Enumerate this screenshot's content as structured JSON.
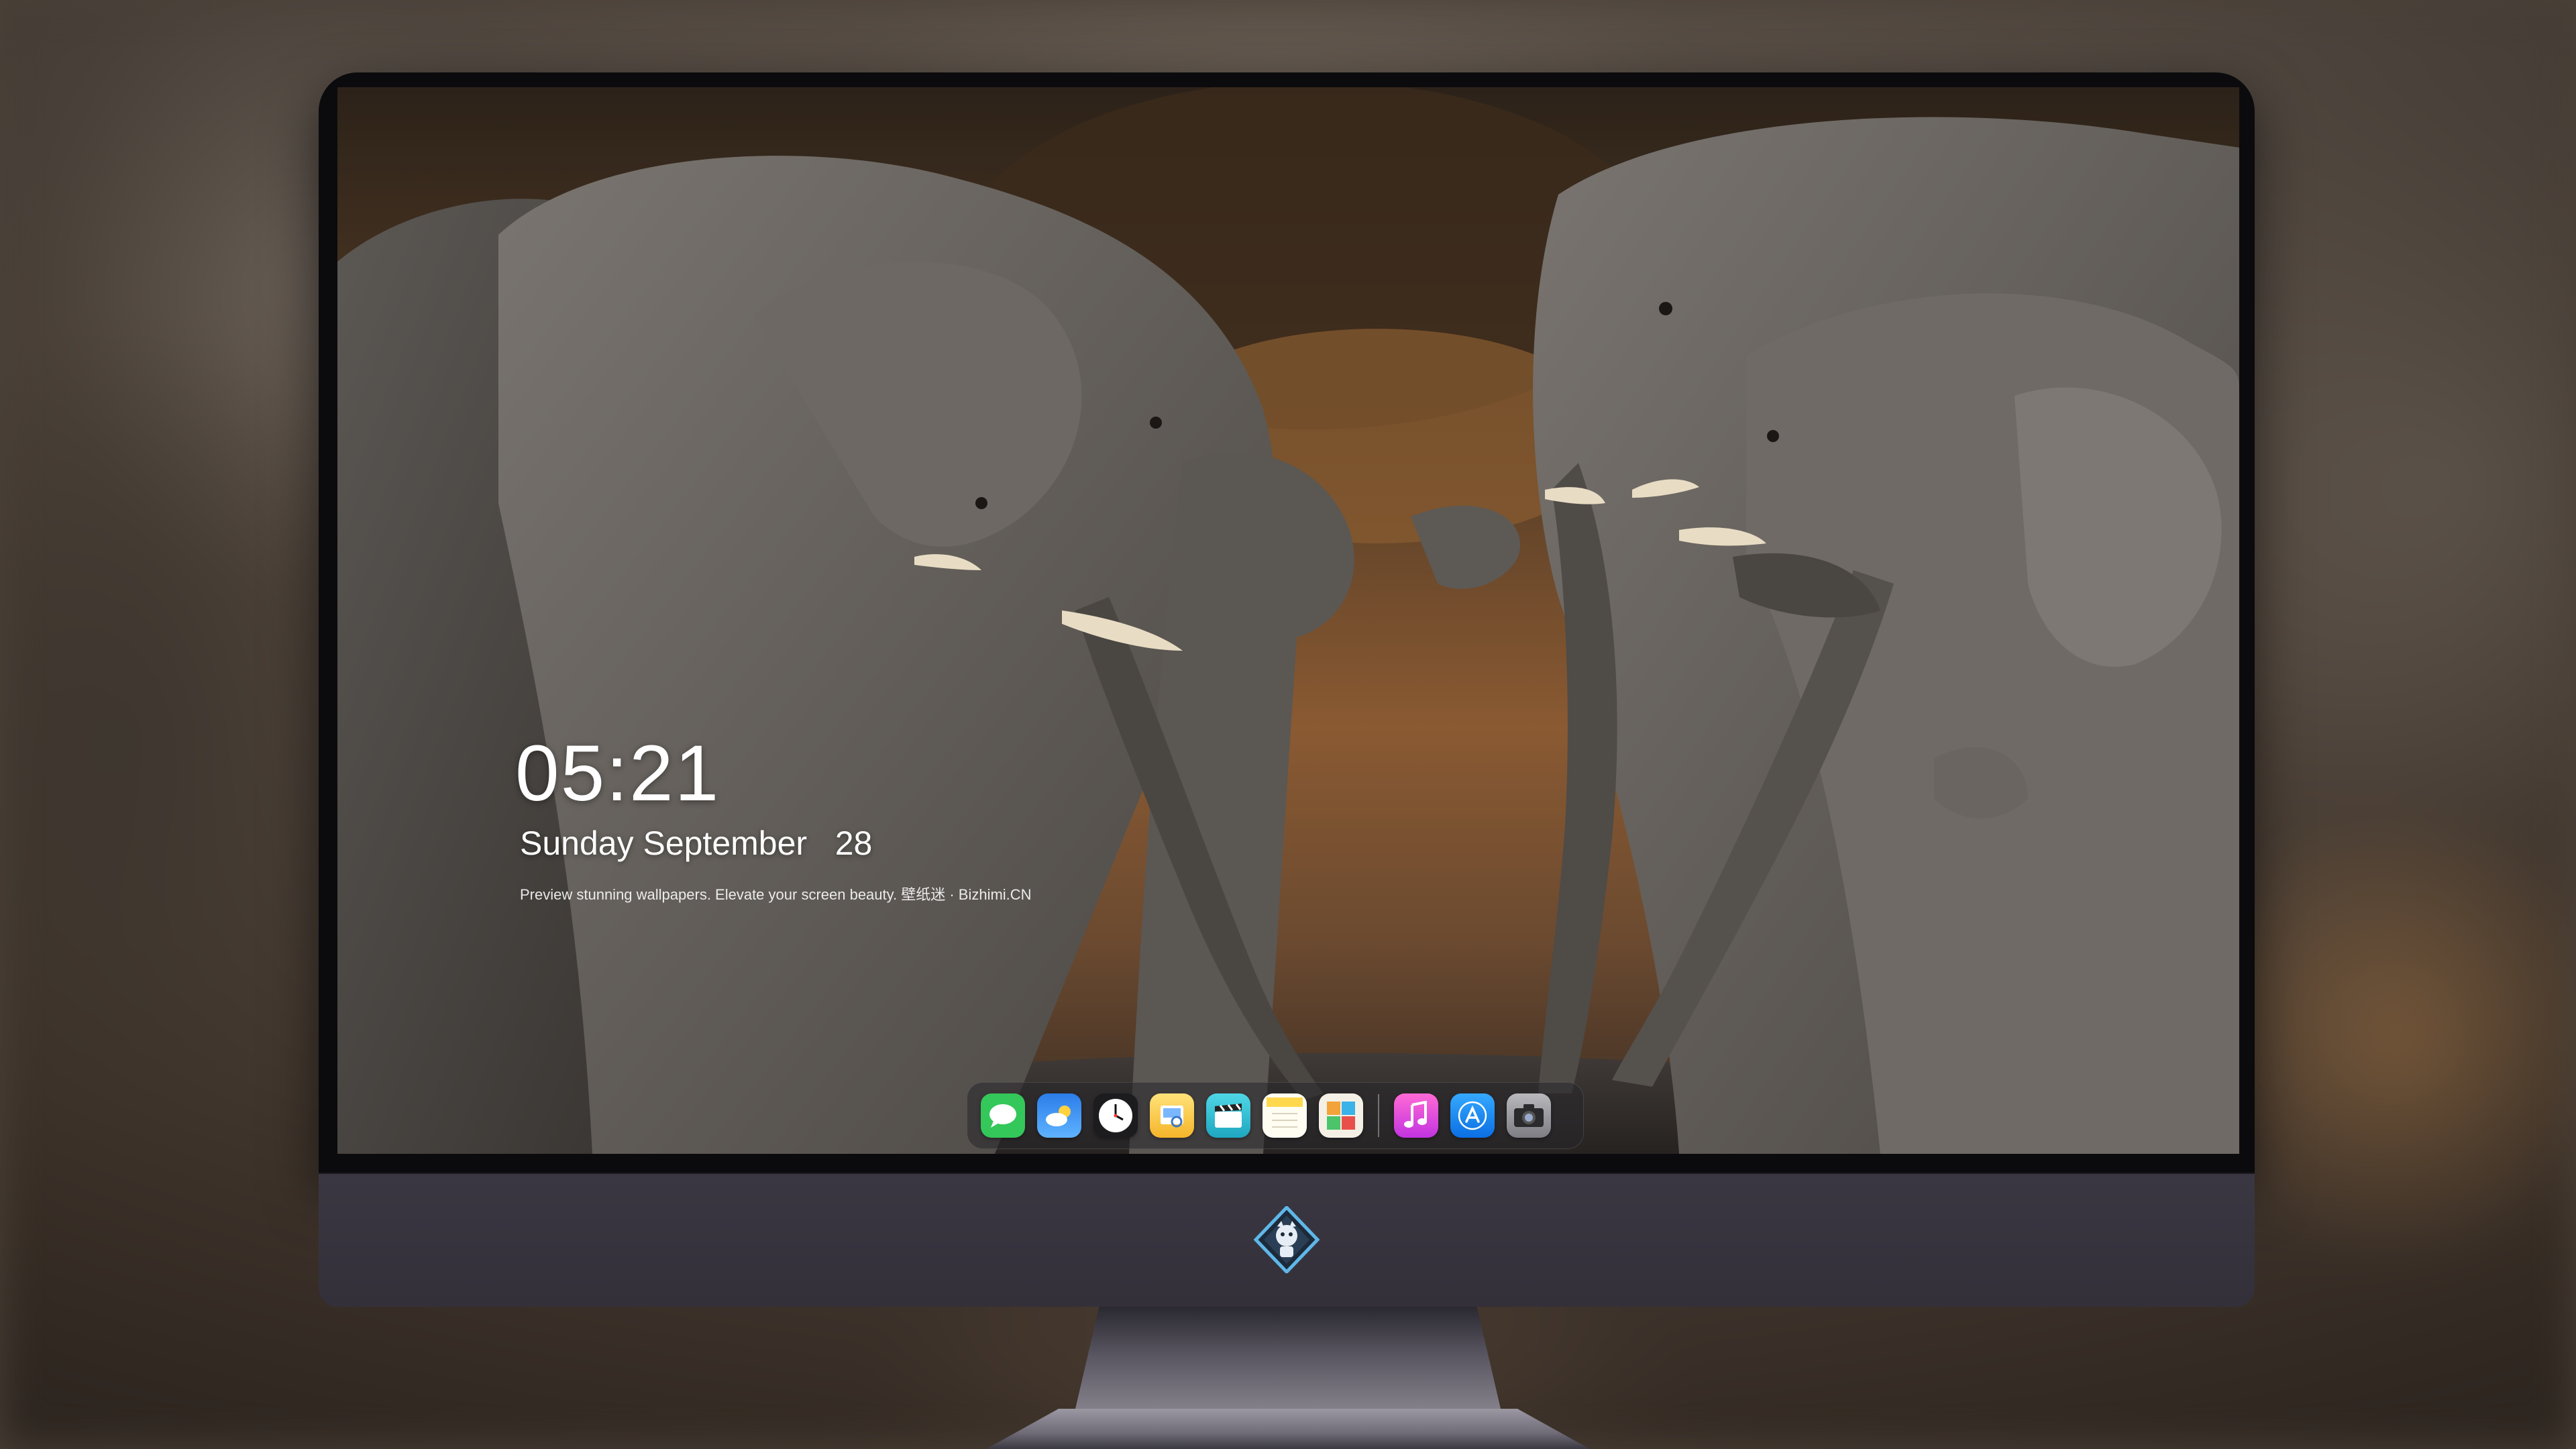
{
  "lock_screen": {
    "time": "05:21",
    "date": "Sunday September   28",
    "tagline": "Preview stunning wallpapers. Elevate your screen beauty. 壁纸迷 · Bizhimi.CN"
  },
  "dock": {
    "apps": [
      {
        "name": "messages-icon",
        "color": "#34c759"
      },
      {
        "name": "weather-icon",
        "color": "#1e90ff"
      },
      {
        "name": "clock-icon",
        "color": "#ffffff"
      },
      {
        "name": "preview-icon",
        "color": "#f5c542"
      },
      {
        "name": "clips-icon",
        "color": "#2ec4d6"
      },
      {
        "name": "notes-icon",
        "color": "#ffd84d"
      },
      {
        "name": "photo-booth-icon",
        "color": "#f2a33a"
      },
      {
        "name": "music-icon",
        "color": "#e94bd6"
      },
      {
        "name": "app-store-icon",
        "color": "#1a8cff"
      },
      {
        "name": "camera-icon",
        "color": "#8e8e93"
      }
    ]
  },
  "colors": {
    "monitor_chin": "#3b3742",
    "bezel": "#0b0b0d"
  }
}
